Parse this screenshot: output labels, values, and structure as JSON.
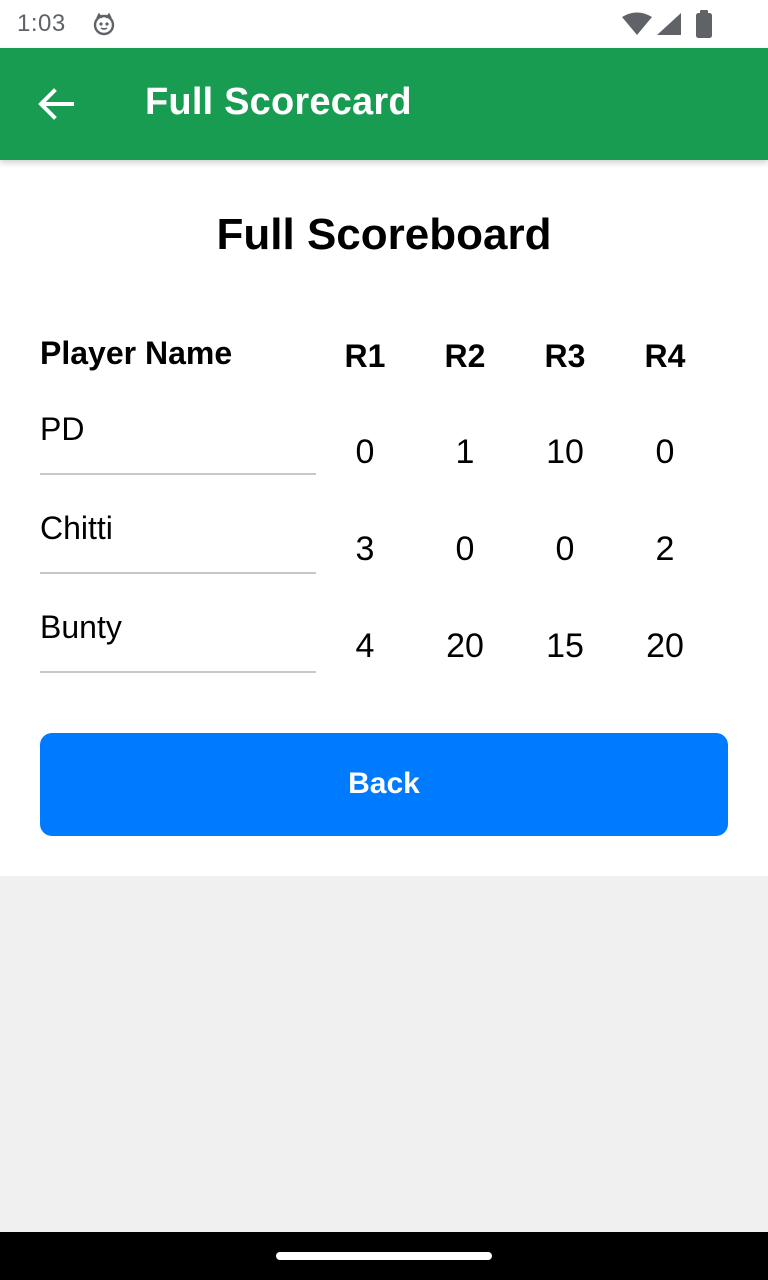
{
  "status_bar": {
    "time": "1:03",
    "icons": [
      "cat-notification-icon",
      "wifi-icon",
      "cell-signal-icon",
      "battery-icon"
    ]
  },
  "app_bar": {
    "title": "Full Scorecard",
    "back_icon": "arrow-back-icon",
    "color": "#179c52"
  },
  "scoreboard": {
    "title": "Full Scoreboard",
    "name_header": "Player Name",
    "round_headers": [
      "R1",
      "R2",
      "R3",
      "R4"
    ],
    "players": [
      {
        "name": "PD",
        "scores": [
          "0",
          "1",
          "10",
          "0"
        ]
      },
      {
        "name": "Chitti",
        "scores": [
          "3",
          "0",
          "0",
          "2"
        ]
      },
      {
        "name": "Bunty",
        "scores": [
          "4",
          "20",
          "15",
          "20"
        ]
      }
    ]
  },
  "back_button": {
    "label": "Back",
    "color": "#007bff"
  },
  "nav_bar": {
    "handle": "gesture-handle"
  }
}
